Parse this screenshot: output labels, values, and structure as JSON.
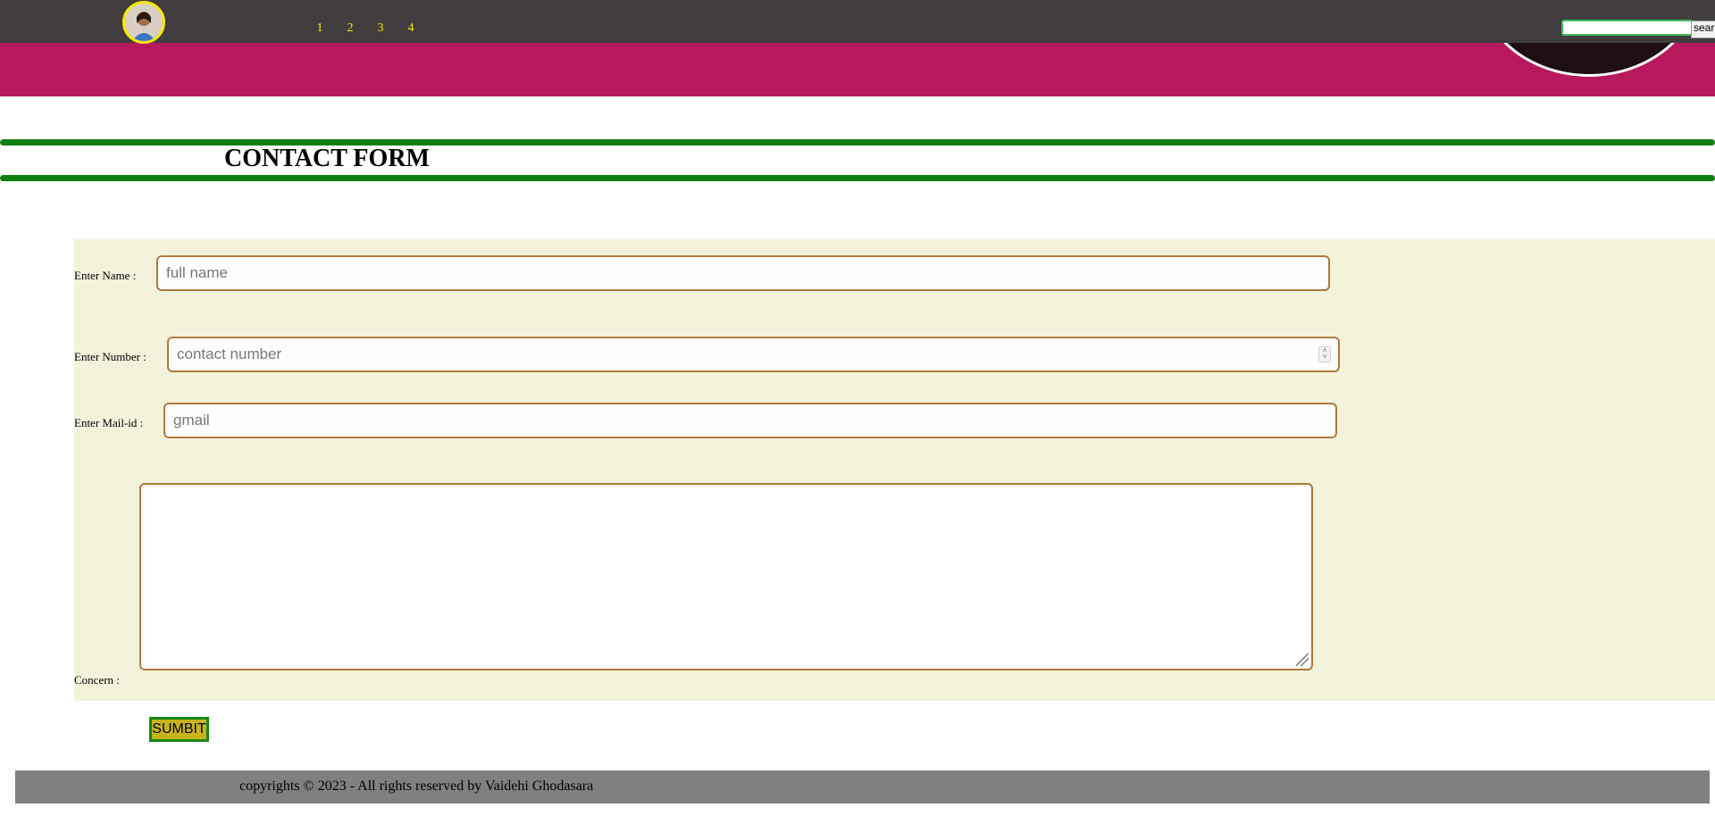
{
  "header": {
    "nav_links": [
      "1",
      "2",
      "3",
      "4"
    ],
    "search_placeholder": "",
    "search_button_label": "searc"
  },
  "page": {
    "title": "CONTACT FORM"
  },
  "form": {
    "name_label": "Enter Name :",
    "name_placeholder": "full name",
    "number_label": "Enter Number :",
    "number_placeholder": "contact number",
    "mail_label": "Enter Mail-id :",
    "mail_placeholder": "gmail",
    "concern_label": "Concern :",
    "submit_label": "SUMBIT"
  },
  "footer": {
    "text": "copyrights © 2023 - All rights reserved by Vaidehi Ghodasara"
  },
  "colors": {
    "header_pink": "#b8195c",
    "navbar_dark": "#413c3e",
    "nav_link_yellow": "#f5e800",
    "divider_green": "#108010",
    "form_background": "#f3f3dc",
    "field_border": "#b07a3a",
    "submit_background": "#c8b419",
    "footer_gray": "#808080"
  },
  "icons": {
    "number_spinner": "spinner-arrows-icon",
    "textarea_resize": "resize-grip-icon"
  }
}
